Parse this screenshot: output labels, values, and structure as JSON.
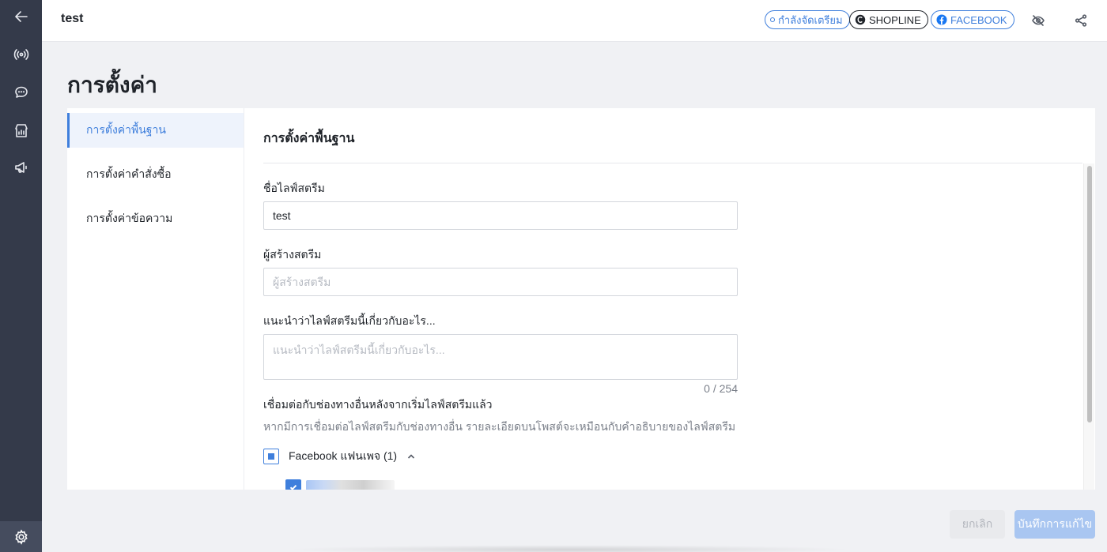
{
  "header": {
    "title": "test",
    "status_label": "กำลังจัดเตรียม",
    "platform_label": "SHOPLINE",
    "channel_label": "FACEBOOK"
  },
  "page": {
    "title": "การตั้งค่า"
  },
  "settings_nav": {
    "items": [
      {
        "label": "การตั้งค่าพื้นฐาน",
        "active": true
      },
      {
        "label": "การตั้งค่าคำสั่งซื้อ",
        "active": false
      },
      {
        "label": "การตั้งค่าข้อความ",
        "active": false
      }
    ]
  },
  "basic_settings": {
    "heading": "การตั้งค่าพื้นฐาน",
    "stream_name": {
      "label": "ชื่อไลฟ์สตรีม",
      "value": "test"
    },
    "creator": {
      "label": "ผู้สร้างสตรีม",
      "placeholder": "ผู้สร้างสตรีม",
      "value": ""
    },
    "description": {
      "label": "แนะนำว่าไลฟ์สตรีมนี้เกี่ยวกับอะไร...",
      "placeholder": "แนะนำว่าไลฟ์สตรีมนี้เกี่ยวกับอะไร...",
      "value": "",
      "char_count": "0 / 254"
    },
    "connect": {
      "label": "เชื่อมต่อกับช่องทางอื่นหลังจากเริ่มไลฟ์สตรีมแล้ว",
      "help": "หากมีการเชื่อมต่อไลฟ์สตรีมกับช่องทางอื่น รายละเอียดบนโพสต์จะเหมือนกับคำอธิบายของไลฟ์สตรีม",
      "group_label": "Facebook แฟนเพจ (1)"
    }
  },
  "footer": {
    "cancel_label": "ยกเลิก",
    "save_label": "บันทึกการแก้ไข"
  },
  "colors": {
    "accent": "#3f7fdc",
    "rail": "#343a4a"
  }
}
